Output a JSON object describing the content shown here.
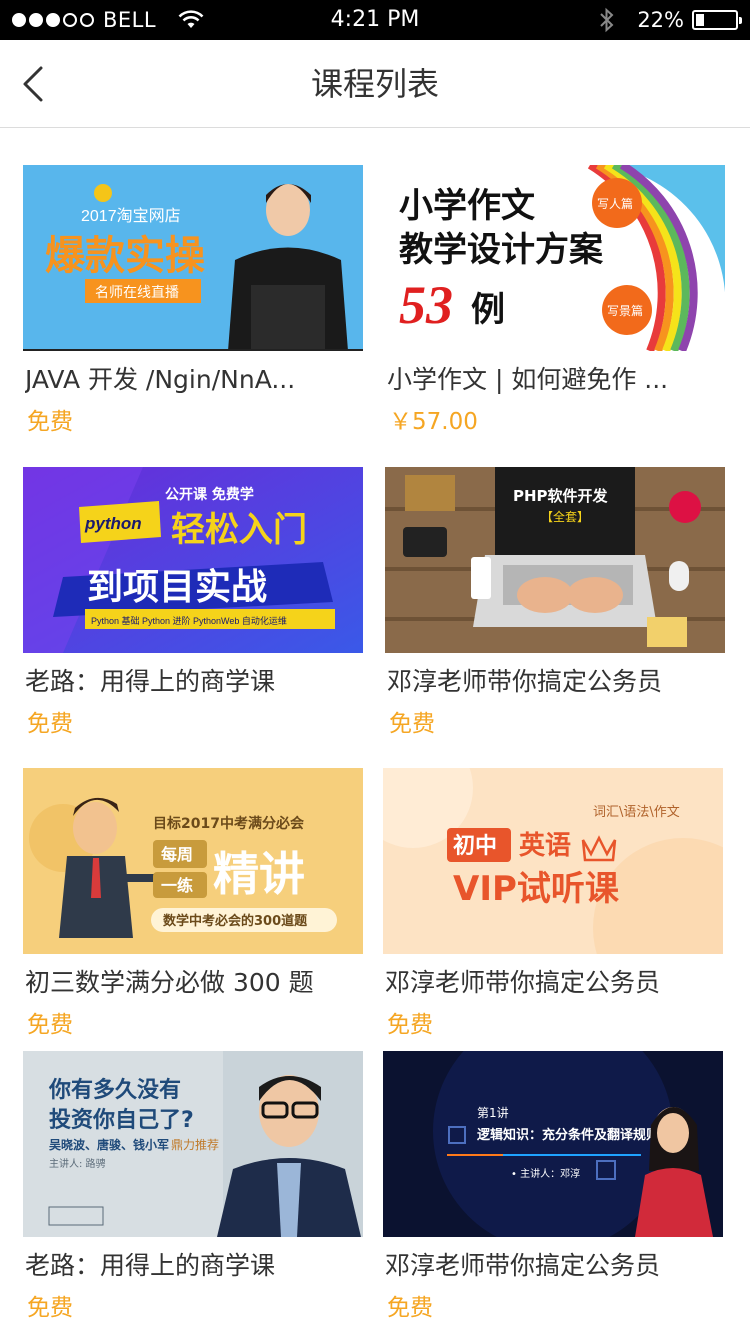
{
  "status_bar": {
    "carrier": "BELL",
    "time": "4:21 PM",
    "battery_percent": "22%",
    "battery_level": 0.22,
    "signal_bars_filled": 3,
    "signal_bars_total": 5
  },
  "nav": {
    "title": "课程列表",
    "back_icon": "chevron-left-icon"
  },
  "colors": {
    "price": "#f5a623",
    "title": "#333333",
    "status_bar": "#000000"
  },
  "courses": [
    {
      "title": "JAVA 开发 /Ngin/NnA...",
      "price": "免费",
      "thumb": {
        "line1": "2017淘宝网店",
        "line2": "爆款实操",
        "line3": "名师在线直播"
      }
    },
    {
      "title": "小学作文 | 如何避免作 ...",
      "price": "￥57.00",
      "thumb": {
        "line1": "小学作文",
        "line2": "教学设计方案",
        "line3": "53",
        "line4": "例",
        "badge1": "写人篇",
        "badge2": "写景篇"
      }
    },
    {
      "title": "老路：用得上的商学课",
      "price": "免费",
      "thumb": {
        "line1": "公开课 免费学",
        "line2": "python",
        "line3": "轻松入门",
        "line4": "到项目实战",
        "line5": "Python 基础  Python 进阶  PythonWeb  自动化运维"
      }
    },
    {
      "title": "邓淳老师带你搞定公务员",
      "price": "免费",
      "thumb": {
        "line1": "PHP软件开发",
        "line2": "【全套】"
      }
    },
    {
      "title": "初三数学满分必做 300 题",
      "price": "免费",
      "thumb": {
        "line1": "目标2017中考满分必会",
        "line2": "每周",
        "line3": "一练",
        "line4": "精讲",
        "line5": "数学中考必会的300道题"
      }
    },
    {
      "title": "邓淳老师带你搞定公务员",
      "price": "免费",
      "thumb": {
        "line1": "词汇\\语法\\作文",
        "line2": "初中",
        "line3": "英语",
        "line4": "VIP试听课"
      }
    },
    {
      "title": "老路：用得上的商学课",
      "price": "免费",
      "thumb": {
        "line1": "你有多久没有",
        "line2": "投资你自己了?",
        "line3": "吴晓波、唐骏、钱小军",
        "line4": "鼎力推荐",
        "line5": "主讲人: 路骋"
      }
    },
    {
      "title": "邓淳老师带你搞定公务员",
      "price": "免费",
      "thumb": {
        "line1": "第1讲",
        "line2": "逻辑知识：充分条件及翻译规则",
        "line3": "• 主讲人：邓淳"
      }
    }
  ]
}
